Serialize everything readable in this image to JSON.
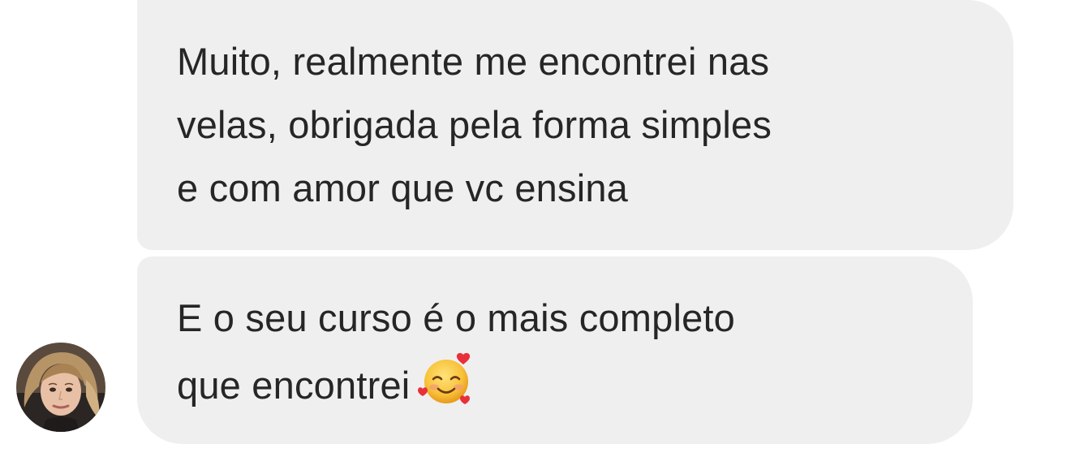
{
  "conversation": {
    "messages": [
      {
        "lines": [
          "Muito, realmente me encontrei nas",
          "velas, obrigada pela forma simples",
          "e com amor que vc ensina"
        ]
      },
      {
        "lines": [
          "E o seu curso é o mais completo",
          "que encontrei"
        ],
        "emoji": "smiling-face-with-hearts-icon"
      }
    ],
    "sender_avatar": "avatar-photo"
  },
  "colors": {
    "bubble_background": "#efefef",
    "text": "#262626",
    "page_background": "#ffffff"
  }
}
